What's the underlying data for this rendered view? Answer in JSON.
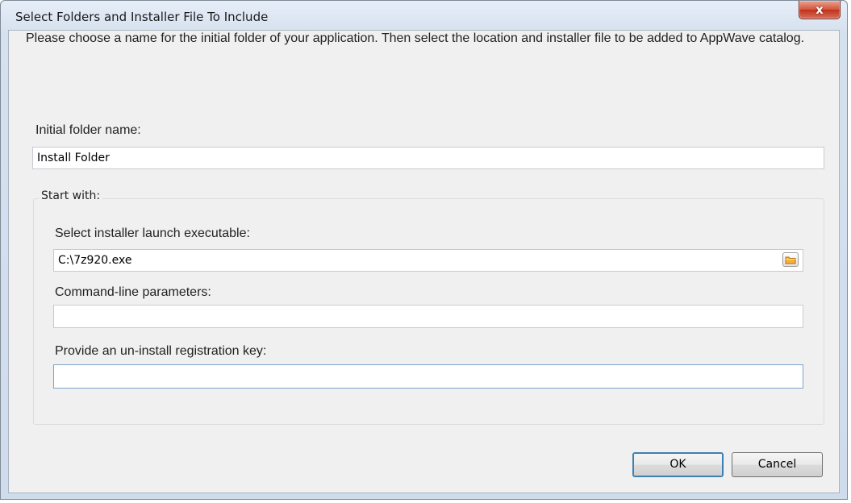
{
  "window": {
    "title": "Select Folders and Installer File To Include",
    "close_label": "x"
  },
  "instructions": "Please choose a name for the initial folder of your application. Then select the location and installer file to be added to AppWave catalog.",
  "initial_folder": {
    "label": "Initial folder name:",
    "value": "Install Folder"
  },
  "start_with": {
    "group_label": "Start with:",
    "installer": {
      "label": "Select installer  launch executable:",
      "value": "C:\\7z920.exe"
    },
    "params": {
      "label": "Command-line parameters:",
      "value": ""
    },
    "uninstall": {
      "label": "Provide an un-install registration key:",
      "value": ""
    }
  },
  "buttons": {
    "ok": "OK",
    "cancel": "Cancel"
  }
}
